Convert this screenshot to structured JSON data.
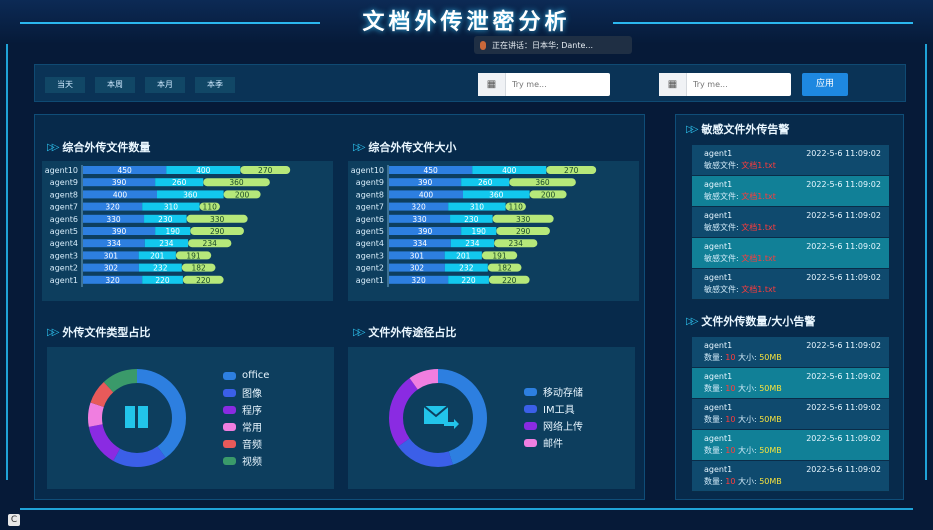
{
  "header": {
    "title": "文档外传泄密分析"
  },
  "speaking": {
    "text": "正在讲话：日本华; Dante..."
  },
  "filters": {
    "periods": [
      "当天",
      "本周",
      "本月",
      "本季"
    ],
    "start_placeholder": "Try me...",
    "end_placeholder": "Try me...",
    "apply_label": "应用",
    "separator": "—"
  },
  "sections": {
    "count_title": "综合外传文件数量",
    "size_title": "综合外传文件大小",
    "type_title": "外传文件类型占比",
    "channel_title": "文件外传途径占比",
    "sensitive_title": "敏感文件外传告警",
    "qty_title": "文件外传数量/大小告警"
  },
  "colors": {
    "series": [
      "#2d7fe0",
      "#12c8ee",
      "#b6e87a"
    ],
    "type_slices": [
      "#2d7fe0",
      "#3b5fe8",
      "#8a2be2",
      "#f07ee0",
      "#e85a5a",
      "#3a9a6a"
    ],
    "channel_slices": [
      "#2d7fe0",
      "#3b5fe8",
      "#8a2be2",
      "#f07ee0"
    ]
  },
  "chart_data": [
    {
      "type": "bar",
      "orientation": "horizontal-stacked",
      "categories": [
        "agent10",
        "agent9",
        "agent8",
        "agent7",
        "agent6",
        "agent5",
        "agent4",
        "agent3",
        "agent2",
        "agent1"
      ],
      "series": [
        {
          "values": [
            450,
            390,
            400,
            320,
            330,
            390,
            334,
            301,
            302,
            320
          ]
        },
        {
          "values": [
            400,
            260,
            360,
            310,
            230,
            190,
            234,
            201,
            232,
            220
          ]
        },
        {
          "values": [
            270,
            360,
            200,
            110,
            330,
            290,
            234,
            191,
            182,
            220
          ]
        }
      ]
    },
    {
      "type": "bar",
      "orientation": "horizontal-stacked",
      "categories": [
        "agent10",
        "agent9",
        "agent8",
        "agent7",
        "agent6",
        "agent5",
        "agent4",
        "agent3",
        "agent2",
        "agent1"
      ],
      "series": [
        {
          "values": [
            450,
            390,
            400,
            320,
            330,
            390,
            334,
            301,
            302,
            320
          ]
        },
        {
          "values": [
            400,
            260,
            360,
            310,
            230,
            190,
            234,
            201,
            232,
            220
          ]
        },
        {
          "values": [
            270,
            360,
            200,
            110,
            330,
            290,
            234,
            191,
            182,
            220
          ]
        }
      ]
    },
    {
      "type": "pie",
      "style": "donut",
      "categories": [
        "office",
        "图像",
        "程序",
        "常用",
        "音频",
        "视频"
      ],
      "values": [
        40,
        18,
        14,
        8,
        8,
        12
      ],
      "icon": "book-icon"
    },
    {
      "type": "pie",
      "style": "donut",
      "categories": [
        "移动存储",
        "IM工具",
        "网络上传",
        "邮件"
      ],
      "values": [
        45,
        20,
        25,
        10
      ],
      "icon": "mail-send-icon"
    }
  ],
  "sensitive_alerts": [
    {
      "agent": "agent1",
      "time": "2022-5-6 11:09:02",
      "label": "敏感文件:",
      "file": "文档1.txt"
    },
    {
      "agent": "agent1",
      "time": "2022-5-6 11:09:02",
      "label": "敏感文件:",
      "file": "文档1.txt"
    },
    {
      "agent": "agent1",
      "time": "2022-5-6 11:09:02",
      "label": "敏感文件:",
      "file": "文档1.txt"
    },
    {
      "agent": "agent1",
      "time": "2022-5-6 11:09:02",
      "label": "敏感文件:",
      "file": "文档1.txt"
    },
    {
      "agent": "agent1",
      "time": "2022-5-6 11:09:02",
      "label": "敏感文件:",
      "file": "文档1.txt"
    }
  ],
  "qty_alerts": [
    {
      "agent": "agent1",
      "time": "2022-5-6 11:09:02",
      "qty_label": "数量:",
      "qty": "10",
      "size_label": "大小:",
      "size": "50MB"
    },
    {
      "agent": "agent1",
      "time": "2022-5-6 11:09:02",
      "qty_label": "数量:",
      "qty": "10",
      "size_label": "大小:",
      "size": "50MB"
    },
    {
      "agent": "agent1",
      "time": "2022-5-6 11:09:02",
      "qty_label": "数量:",
      "qty": "10",
      "size_label": "大小:",
      "size": "50MB"
    },
    {
      "agent": "agent1",
      "time": "2022-5-6 11:09:02",
      "qty_label": "数量:",
      "qty": "10",
      "size_label": "大小:",
      "size": "50MB"
    },
    {
      "agent": "agent1",
      "time": "2022-5-6 11:09:02",
      "qty_label": "数量:",
      "qty": "10",
      "size_label": "大小:",
      "size": "50MB"
    }
  ]
}
